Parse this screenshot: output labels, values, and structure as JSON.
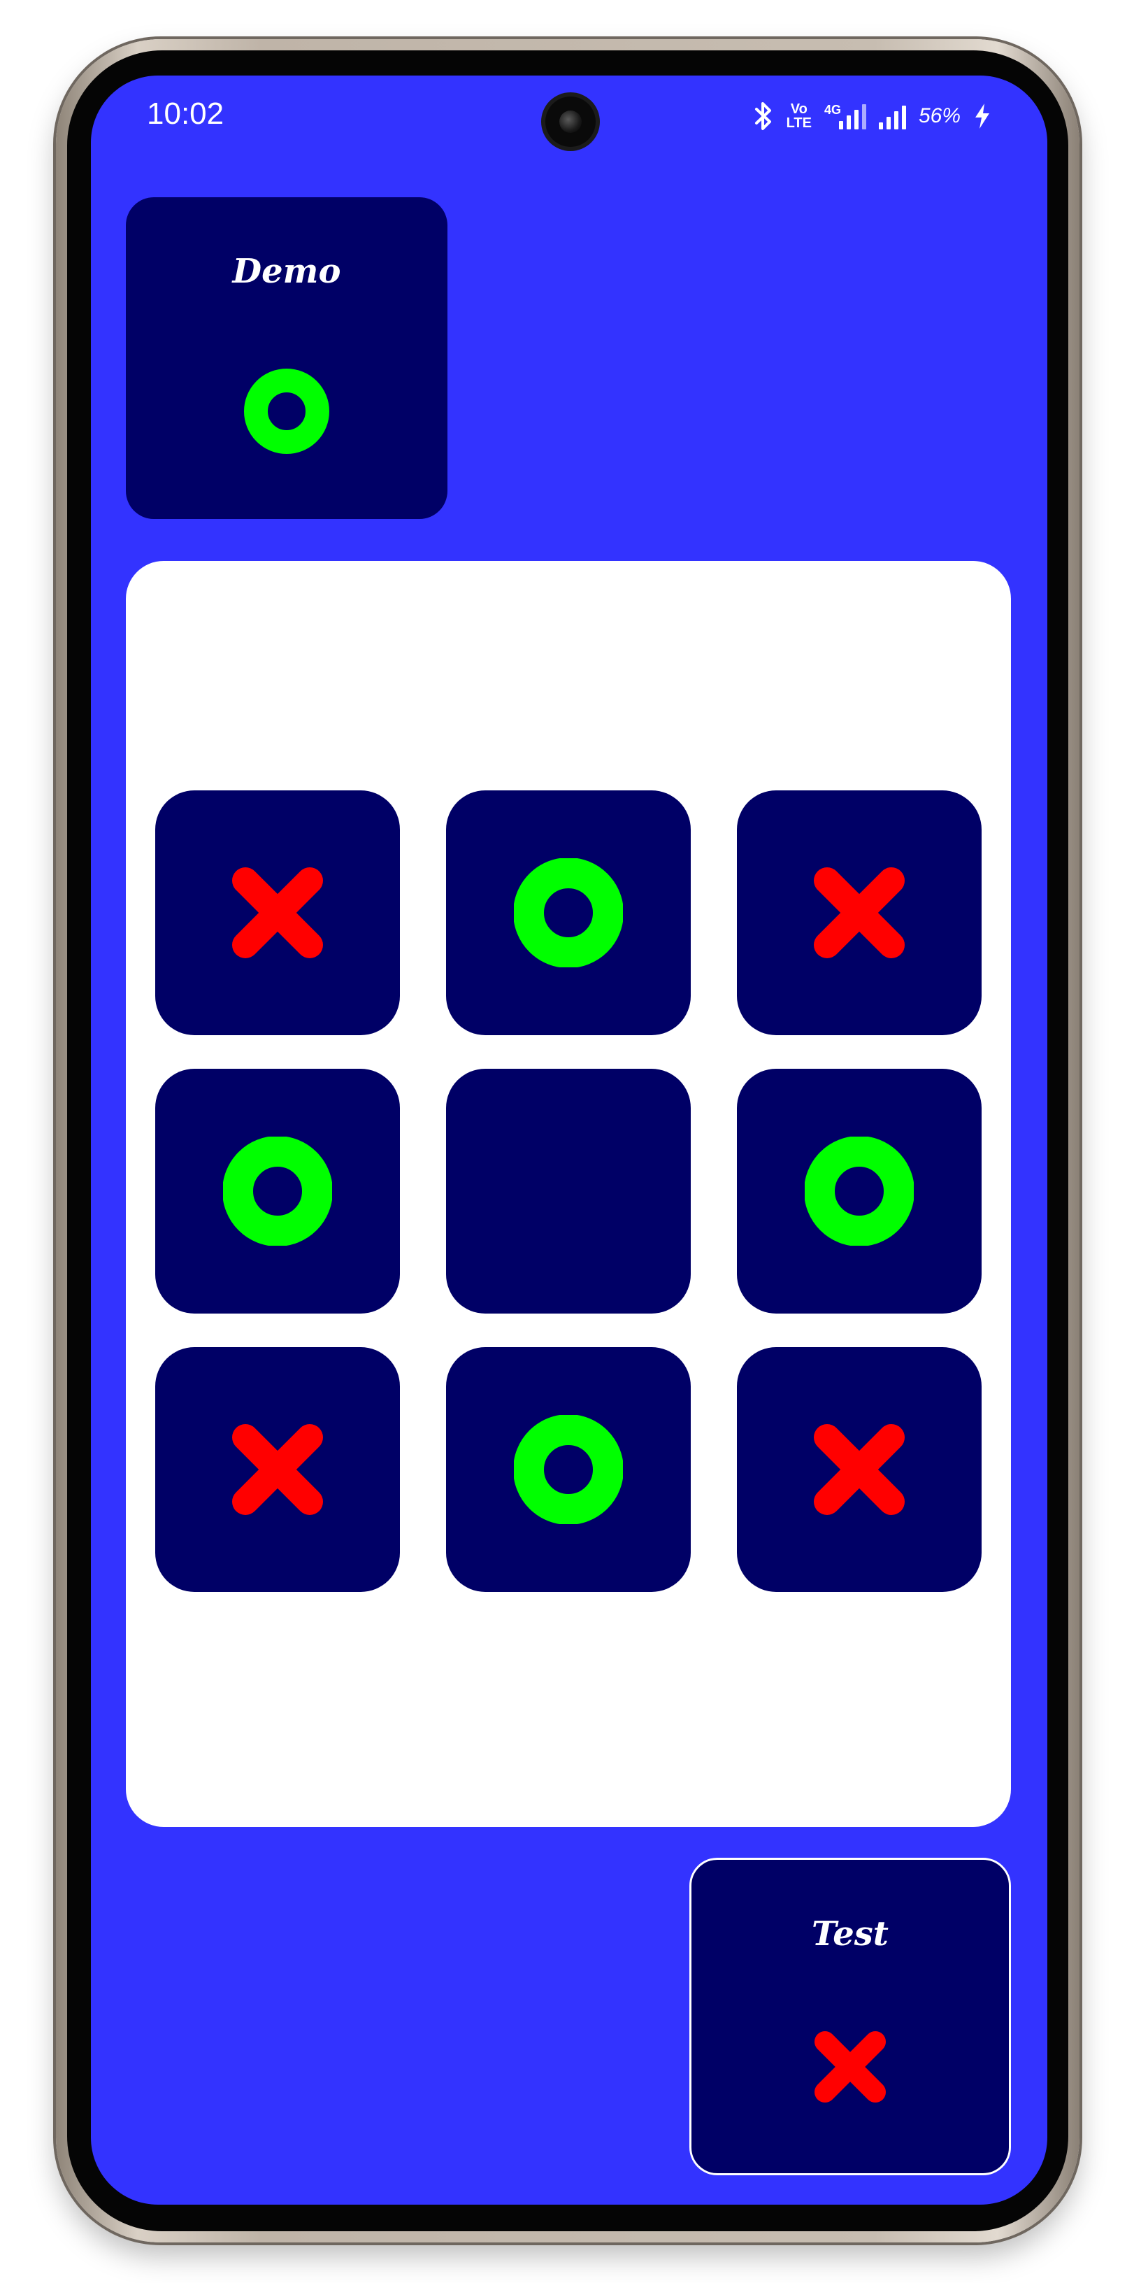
{
  "status_bar": {
    "time": "10:02",
    "volte_line1": "Vo",
    "volte_line2": "LTE",
    "network_type": "4G",
    "battery": "56%",
    "icons": [
      "bluetooth-icon",
      "volte-icon",
      "signal-icon",
      "charging-icon"
    ]
  },
  "players": {
    "top": {
      "name": "Demo",
      "mark": "O"
    },
    "bottom": {
      "name": "Test",
      "mark": "X"
    }
  },
  "board": {
    "cells": [
      "X",
      "O",
      "X",
      "O",
      "",
      "O",
      "X",
      "O",
      "X"
    ]
  },
  "colors": {
    "screen_background": "#3333ff",
    "card_background": "#000066",
    "board_background": "#ffffff",
    "x_mark": "#ff0000",
    "o_mark": "#00ff00",
    "text": "#ffffff"
  }
}
